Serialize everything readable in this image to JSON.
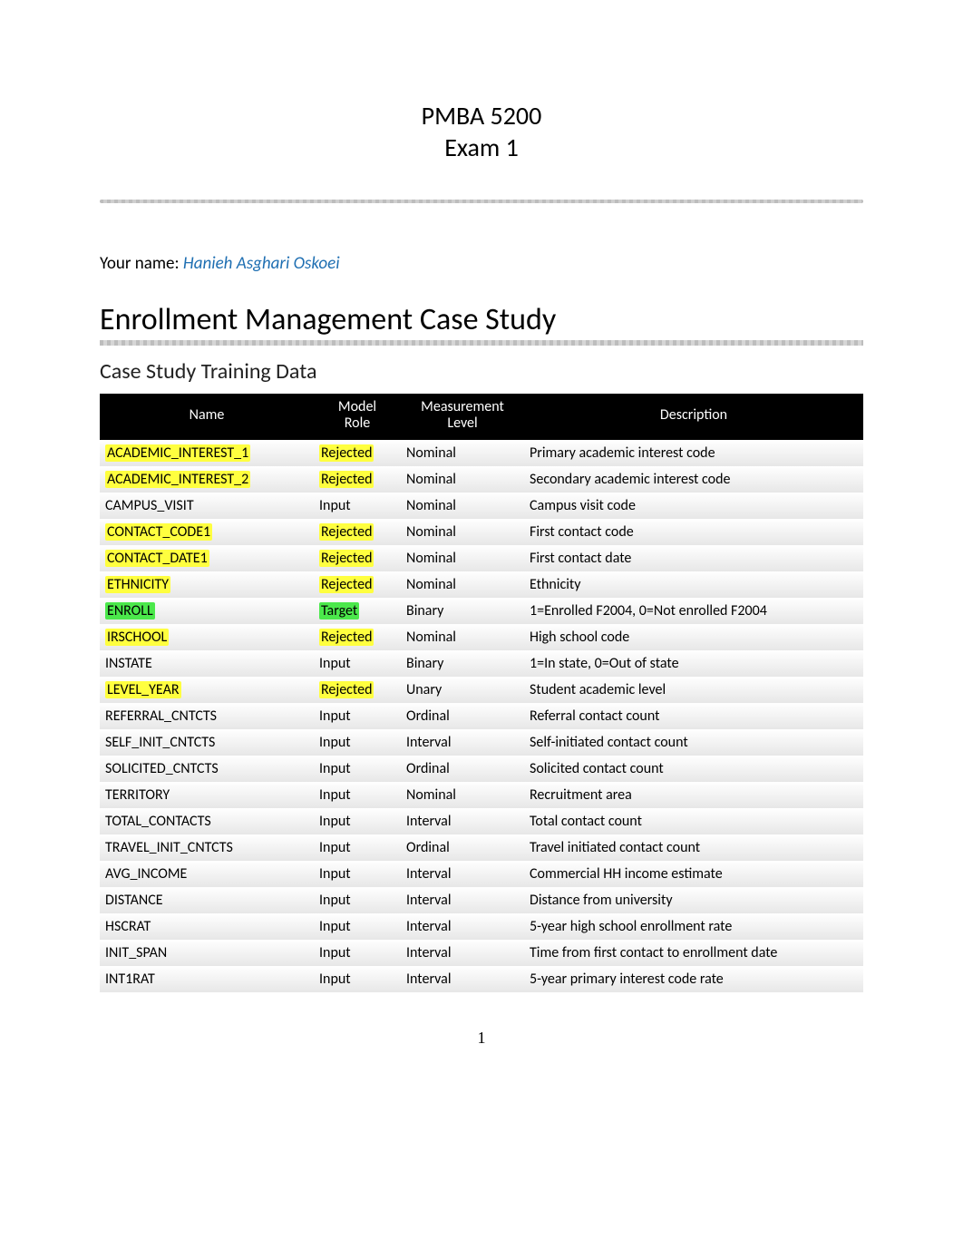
{
  "header": {
    "line1": "PMBA 5200",
    "line2": "Exam 1"
  },
  "your_name_label": "Your name: ",
  "your_name_value": "Hanieh Asghari Oskoei",
  "h1": "Enrollment Management Case Study",
  "h2": "Case Study Training Data",
  "table": {
    "headers": {
      "name": "Name",
      "role_l1": "Model",
      "role_l2": "Role",
      "lvl_l1": "Measurement",
      "lvl_l2": "Level",
      "desc": "Description"
    },
    "rows": [
      {
        "name": "ACADEMIC_INTEREST_1",
        "name_hl": "yellow",
        "role": "Rejected",
        "role_hl": "yellow",
        "lvl": "Nominal",
        "desc": "Primary academic interest code"
      },
      {
        "name": "ACADEMIC_INTEREST_2",
        "name_hl": "yellow",
        "role": "Rejected",
        "role_hl": "yellow",
        "lvl": "Nominal",
        "desc": "Secondary academic interest code"
      },
      {
        "name": "CAMPUS_VISIT",
        "name_hl": "",
        "role": "Input",
        "role_hl": "",
        "lvl": "Nominal",
        "desc": "Campus visit code"
      },
      {
        "name": "CONTACT_CODE1",
        "name_hl": "yellow",
        "role": "Rejected",
        "role_hl": "yellow",
        "lvl": "Nominal",
        "desc": "First contact code"
      },
      {
        "name": "CONTACT_DATE1",
        "name_hl": "yellow",
        "role": "Rejected",
        "role_hl": "yellow",
        "lvl": "Nominal",
        "desc": "First contact date"
      },
      {
        "name": "ETHNICITY",
        "name_hl": "yellow",
        "role": "Rejected",
        "role_hl": "yellow",
        "lvl": "Nominal",
        "desc": "Ethnicity"
      },
      {
        "name": "ENROLL",
        "name_hl": "green",
        "role": "Target",
        "role_hl": "green",
        "lvl": "Binary",
        "desc": "1=Enrolled F2004, 0=Not enrolled F2004"
      },
      {
        "name": "IRSCHOOL",
        "name_hl": "yellow",
        "role": "Rejected",
        "role_hl": "yellow",
        "lvl": "Nominal",
        "desc": "High school code"
      },
      {
        "name": "INSTATE",
        "name_hl": "",
        "role": "Input",
        "role_hl": "",
        "lvl": "Binary",
        "desc": "1=In state, 0=Out of state"
      },
      {
        "name": "LEVEL_YEAR",
        "name_hl": "yellow",
        "role": "Rejected",
        "role_hl": "yellow",
        "lvl": "Unary",
        "desc": "Student academic level"
      },
      {
        "name": "REFERRAL_CNTCTS",
        "name_hl": "",
        "role": "Input",
        "role_hl": "",
        "lvl": "Ordinal",
        "desc": "Referral contact count"
      },
      {
        "name": "SELF_INIT_CNTCTS",
        "name_hl": "",
        "role": "Input",
        "role_hl": "",
        "lvl": "Interval",
        "desc": "Self-initiated contact count"
      },
      {
        "name": "SOLICITED_CNTCTS",
        "name_hl": "",
        "role": "Input",
        "role_hl": "",
        "lvl": "Ordinal",
        "desc": "Solicited contact count"
      },
      {
        "name": "TERRITORY",
        "name_hl": "",
        "role": "Input",
        "role_hl": "",
        "lvl": "Nominal",
        "desc": "Recruitment area"
      },
      {
        "name": "TOTAL_CONTACTS",
        "name_hl": "",
        "role": "Input",
        "role_hl": "",
        "lvl": "Interval",
        "desc": "Total contact count"
      },
      {
        "name": "TRAVEL_INIT_CNTCTS",
        "name_hl": "",
        "role": "Input",
        "role_hl": "",
        "lvl": "Ordinal",
        "desc": "Travel initiated contact count"
      },
      {
        "name": "AVG_INCOME",
        "name_hl": "",
        "role": "Input",
        "role_hl": "",
        "lvl": "Interval",
        "desc": "Commercial  HH income estimate"
      },
      {
        "name": "DISTANCE",
        "name_hl": "",
        "role": "Input",
        "role_hl": "",
        "lvl": "Interval",
        "desc": "Distance from university"
      },
      {
        "name": "HSCRAT",
        "name_hl": "",
        "role": "Input",
        "role_hl": "",
        "lvl": "Interval",
        "desc": "5-year high school enrollment rate"
      },
      {
        "name": "INIT_SPAN",
        "name_hl": "",
        "role": "Input",
        "role_hl": "",
        "lvl": "Interval",
        "desc": "Time from first contact to enrollment date"
      },
      {
        "name": "INT1RAT",
        "name_hl": "",
        "role": "Input",
        "role_hl": "",
        "lvl": "Interval",
        "desc": "5-year primary interest code rate"
      }
    ]
  },
  "page_number": "1"
}
